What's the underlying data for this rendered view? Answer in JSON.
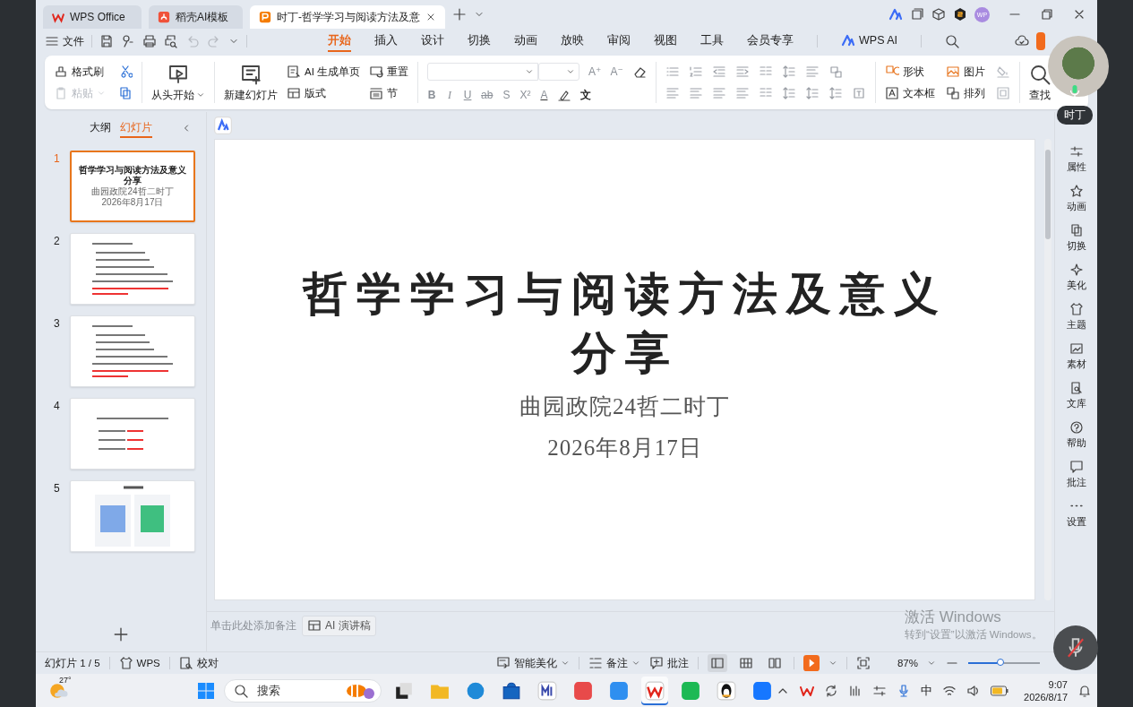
{
  "title_bar": {
    "tabs": [
      {
        "label": "WPS Office",
        "selected": false,
        "kind": "home"
      },
      {
        "label": "稻壳AI模板",
        "selected": false,
        "kind": "template"
      },
      {
        "label": "时丁-哲学学习与阅读方法及意",
        "selected": true,
        "kind": "document"
      }
    ],
    "account_initials": "WP"
  },
  "menu": {
    "file": "文件",
    "tabs": [
      {
        "label": "开始",
        "selected": true
      },
      {
        "label": "插入",
        "selected": false
      },
      {
        "label": "设计",
        "selected": false
      },
      {
        "label": "切换",
        "selected": false
      },
      {
        "label": "动画",
        "selected": false
      },
      {
        "label": "放映",
        "selected": false
      },
      {
        "label": "审阅",
        "selected": false
      },
      {
        "label": "视图",
        "selected": false
      },
      {
        "label": "工具",
        "selected": false
      },
      {
        "label": "会员专享",
        "selected": false
      }
    ],
    "ai": "WPS AI"
  },
  "ribbon": {
    "format_painter": "格式刷",
    "paste": {
      "label": "粘贴",
      "disabled": true
    },
    "play_from_start": "从头开始",
    "new_slide": "新建幻灯片",
    "ai_page": "AI 生成单页",
    "layout": "版式",
    "reset": "重置",
    "section": "节",
    "font_grow": "A⁺",
    "font_shrink": "A⁻",
    "text_format": [
      "B",
      "I",
      "U",
      "ab",
      "S",
      "X²",
      "A"
    ],
    "text_effect": "文",
    "shape": "形状",
    "picture": "图片",
    "textbox": "文本框",
    "arrange": "排列",
    "find": "查找"
  },
  "left_panel": {
    "tabs": [
      {
        "label": "大纲",
        "selected": false
      },
      {
        "label": "幻灯片",
        "selected": true
      }
    ],
    "slides": [
      {
        "number": "1",
        "selected": true,
        "kind": "title",
        "title": "哲学学习与阅读方法及意义",
        "title_2": "分享",
        "lines": [
          "曲园政院24哲二时丁",
          "2026年8月17日"
        ]
      },
      {
        "number": "2",
        "selected": false,
        "kind": "text"
      },
      {
        "number": "3",
        "selected": false,
        "kind": "text"
      },
      {
        "number": "4",
        "selected": false,
        "kind": "list"
      },
      {
        "number": "5",
        "selected": false,
        "kind": "qr"
      }
    ]
  },
  "slide": {
    "title_lines": [
      "哲学学习与阅读方法及意义",
      "分享"
    ],
    "subtitle": "曲园政院24哲二时丁",
    "date": "2026年8月17日"
  },
  "notes": {
    "placeholder": "单击此处添加备注",
    "ai_button": "AI 演讲稿"
  },
  "right_sidebar": [
    "属性",
    "动画",
    "切换",
    "美化",
    "主题",
    "素材",
    "文库",
    "帮助",
    "批注",
    "设置"
  ],
  "status_bar": {
    "slide_count": "幻灯片 1 / 5",
    "theme": "WPS",
    "proofread": "校对",
    "beautify": "智能美化",
    "notes": "备注",
    "comments": "批注",
    "view_modes": [
      {
        "selected": true
      },
      {
        "selected": false
      },
      {
        "selected": false
      }
    ],
    "zoom": "87%",
    "zoom_slider": {
      "level": 0.45
    }
  },
  "taskbar": {
    "temperature": "27°",
    "search": "搜索",
    "ime": "中",
    "time": "9:07",
    "date": "2026/8/17"
  },
  "call_overlay": {
    "name": "时丁"
  },
  "activation_notice": {
    "title": "激活 Windows",
    "text": "转到“设置”以激活 Windows。"
  }
}
